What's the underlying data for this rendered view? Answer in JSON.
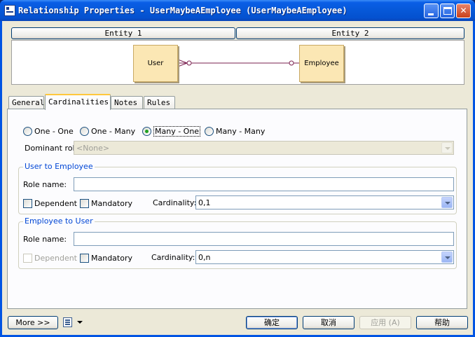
{
  "window": {
    "title": "Relationship Properties - UserMaybeAEmployee (UserMaybeAEmployee)",
    "controls": [
      "minimize",
      "maximize",
      "close"
    ]
  },
  "entities": {
    "entity1_label": "Entity 1",
    "entity2_label": "Entity 2",
    "left_name": "User",
    "right_name": "Employee"
  },
  "tabs": [
    {
      "label": "General",
      "active": false
    },
    {
      "label": "Cardinalities",
      "active": true
    },
    {
      "label": "Notes",
      "active": false
    },
    {
      "label": "Rules",
      "active": false
    }
  ],
  "cardinality_options": [
    {
      "label": "One - One",
      "selected": false
    },
    {
      "label": "One - Many",
      "selected": false
    },
    {
      "label": "Many - One",
      "selected": true
    },
    {
      "label": "Many - Many",
      "selected": false
    }
  ],
  "dominant_role": {
    "label": "Dominant role:",
    "value": "<None>",
    "disabled": true
  },
  "user_to_employee": {
    "title": "User to Employee",
    "role_name_label": "Role name:",
    "role_name_value": "",
    "dependent_label": "Dependent",
    "dependent_checked": false,
    "mandatory_label": "Mandatory",
    "mandatory_checked": false,
    "cardinality_label": "Cardinality:",
    "cardinality_value": "0,1"
  },
  "employee_to_user": {
    "title": "Employee to User",
    "role_name_label": "Role name:",
    "role_name_value": "",
    "dependent_label": "Dependent",
    "dependent_checked": false,
    "dependent_disabled": true,
    "mandatory_label": "Mandatory",
    "mandatory_checked": false,
    "cardinality_label": "Cardinality:",
    "cardinality_value": "0,n"
  },
  "footer": {
    "more_label": "More >>",
    "ok_label": "确定",
    "cancel_label": "取消",
    "apply_label": "应用 (A)",
    "help_label": "帮助"
  },
  "colors": {
    "title_bar": "#0558d8",
    "entity_fill": "#fbe7b4",
    "relationship_line": "#7a1f4f",
    "group_title": "#0046d5",
    "radio_dot": "#21a121"
  }
}
